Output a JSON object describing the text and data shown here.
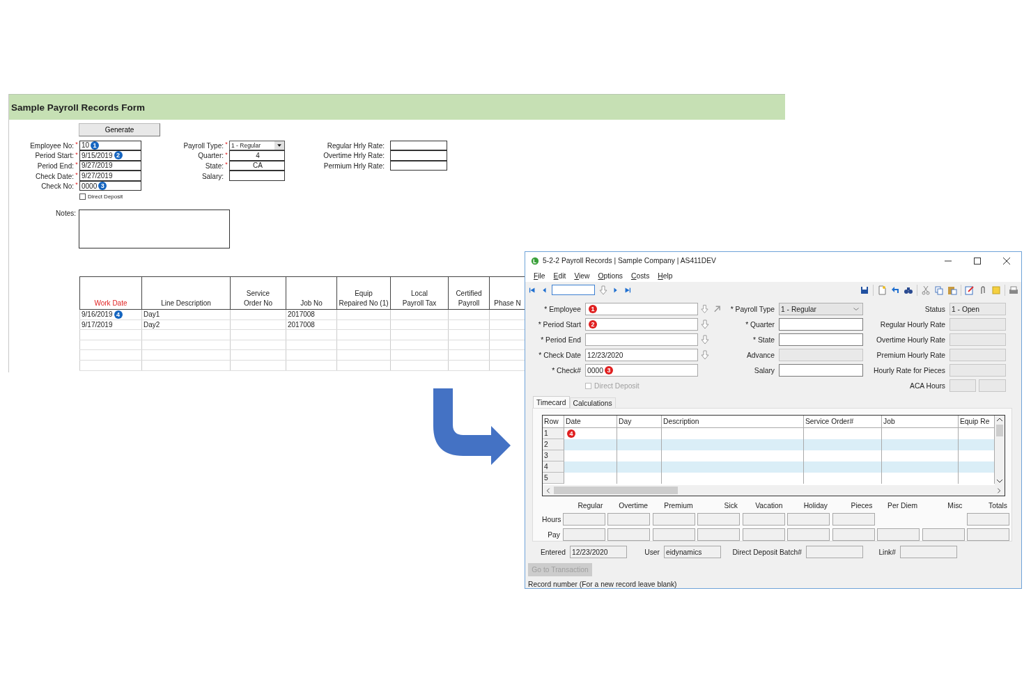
{
  "sheet": {
    "title": "Sample Payroll Records Form",
    "generate_button": "Generate",
    "fields_left": [
      {
        "label": "Employee No:",
        "required_mark": "*",
        "value": "10",
        "marker": "1"
      },
      {
        "label": "Period Start:",
        "required_mark": "*",
        "value": "9/15/2019",
        "marker": "2"
      },
      {
        "label": "Period End:",
        "required_mark": "*",
        "value": "9/27/2019"
      },
      {
        "label": "Check Date:",
        "required_mark": "*",
        "value": "9/27/2019"
      },
      {
        "label": "Check No:",
        "required_mark": "*",
        "value": "0000",
        "marker": "3"
      }
    ],
    "fields_mid": [
      {
        "label": "Payroll Type:",
        "required_mark": "*",
        "value": "1 - Regular",
        "kind": "dropdown"
      },
      {
        "label": "Quarter:",
        "required_mark": "*",
        "value": "4",
        "kind": "text"
      },
      {
        "label": "State:",
        "required_mark": "*",
        "value": "CA",
        "kind": "text"
      },
      {
        "label": "Salary:",
        "kind": "text"
      }
    ],
    "fields_right": [
      {
        "label": "Regular Hrly Rate:"
      },
      {
        "label": "Overtime Hrly Rate:"
      },
      {
        "label": "Permium Hrly Rate:"
      }
    ],
    "direct_deposit": {
      "label": "Direct Deposit",
      "checked": false
    },
    "notes": {
      "label": "Notes:"
    },
    "table": {
      "columns": [
        {
          "label": "Work Date",
          "required": true
        },
        {
          "label": "Line Description",
          "required": false
        },
        {
          "label": "Service\nOrder No",
          "required": false
        },
        {
          "label": "Job No",
          "required": false
        },
        {
          "label": "Equip\nRepaired No (1)",
          "required": false
        },
        {
          "label": "Local\nPayroll Tax",
          "required": false
        },
        {
          "label": "Certified\nPayroll",
          "required": false
        },
        {
          "label": "Phase N",
          "required": false
        }
      ],
      "rows": [
        {
          "work_date": "9/16/2019",
          "marker": "4",
          "line_description": "Day1",
          "job_no": "2017008"
        },
        {
          "work_date": "9/17/2019",
          "line_description": "Day2",
          "job_no": "2017008"
        }
      ]
    }
  },
  "window": {
    "title": "5-2-2 Payroll Records | Sample Company | AS411DEV",
    "menu": [
      "File",
      "Edit",
      "View",
      "Options",
      "Costs",
      "Help"
    ],
    "fields_left": [
      {
        "label": "* Employee",
        "marker": "1",
        "buttons": [
          {
            "kind": "lookup"
          },
          {
            "kind": "drill"
          }
        ]
      },
      {
        "label": "* Period Start",
        "marker": "2",
        "buttons": [
          {
            "kind": "lookup"
          }
        ]
      },
      {
        "label": "* Period End",
        "buttons": [
          {
            "kind": "lookup"
          }
        ]
      },
      {
        "label": "* Check Date",
        "value": "12/23/2020",
        "buttons": [
          {
            "kind": "lookup"
          }
        ]
      },
      {
        "label": "* Check#",
        "value": "0000",
        "marker": "3"
      }
    ],
    "direct_deposit": {
      "label": "Direct Deposit",
      "checked": false,
      "disabled": true
    },
    "fields_mid": [
      {
        "label": "* Payroll Type",
        "value": "1 - Regular",
        "kind": "dropdown"
      },
      {
        "label": "* Quarter",
        "kind": "text",
        "disabled": false
      },
      {
        "label": "* State",
        "kind": "text",
        "disabled": false
      },
      {
        "label": "Advance",
        "kind": "text",
        "disabled": true
      },
      {
        "label": "Salary",
        "kind": "text",
        "disabled": false
      }
    ],
    "fields_right": [
      {
        "label": "Status",
        "value": "1 - Open"
      },
      {
        "label": "Regular Hourly Rate"
      },
      {
        "label": "Overtime Hourly Rate"
      },
      {
        "label": "Premium Hourly Rate"
      },
      {
        "label": "Hourly Rate for Pieces"
      }
    ],
    "aca_hours": {
      "label": "ACA Hours"
    },
    "tabs": [
      {
        "label": "Timecard",
        "selected": true
      },
      {
        "label": "Calculations",
        "selected": false
      }
    ],
    "grid": {
      "columns": [
        "Row",
        "Date",
        "Day",
        "Description",
        "Service Order#",
        "Job",
        "Equip Re"
      ],
      "rows": [
        {
          "row": "1",
          "marker": "4"
        },
        {
          "row": "2"
        },
        {
          "row": "3"
        },
        {
          "row": "4"
        },
        {
          "row": "5"
        }
      ]
    },
    "totals": {
      "columns": [
        "Regular",
        "Overtime",
        "Premium",
        "Sick",
        "Vacation",
        "Holiday",
        "Pieces",
        "Per Diem",
        "Misc",
        "Totals"
      ],
      "rows": [
        {
          "label": "Hours",
          "cells": [
            {
              "kind": "field"
            },
            {
              "kind": "field"
            },
            {
              "kind": "field"
            },
            {
              "kind": "field"
            },
            {
              "kind": "field"
            },
            {
              "kind": "field"
            },
            {
              "kind": "field"
            },
            {
              "kind": "blank"
            },
            {
              "kind": "blank"
            },
            {
              "kind": "field"
            }
          ]
        },
        {
          "label": "Pay",
          "cells": [
            {
              "kind": "field"
            },
            {
              "kind": "field"
            },
            {
              "kind": "field"
            },
            {
              "kind": "field"
            },
            {
              "kind": "field"
            },
            {
              "kind": "field"
            },
            {
              "kind": "field"
            },
            {
              "kind": "field"
            },
            {
              "kind": "field"
            },
            {
              "kind": "field"
            }
          ]
        }
      ]
    },
    "footer_fields": [
      {
        "label": "Entered",
        "value": "12/23/2020"
      },
      {
        "label": "User",
        "value": "eidynamics"
      },
      {
        "label": "Direct Deposit Batch#"
      },
      {
        "label": "Link#"
      }
    ],
    "go_button": {
      "label": "Go to Transaction",
      "disabled": true
    },
    "status_bar": "Record number (For a new record leave blank)"
  }
}
